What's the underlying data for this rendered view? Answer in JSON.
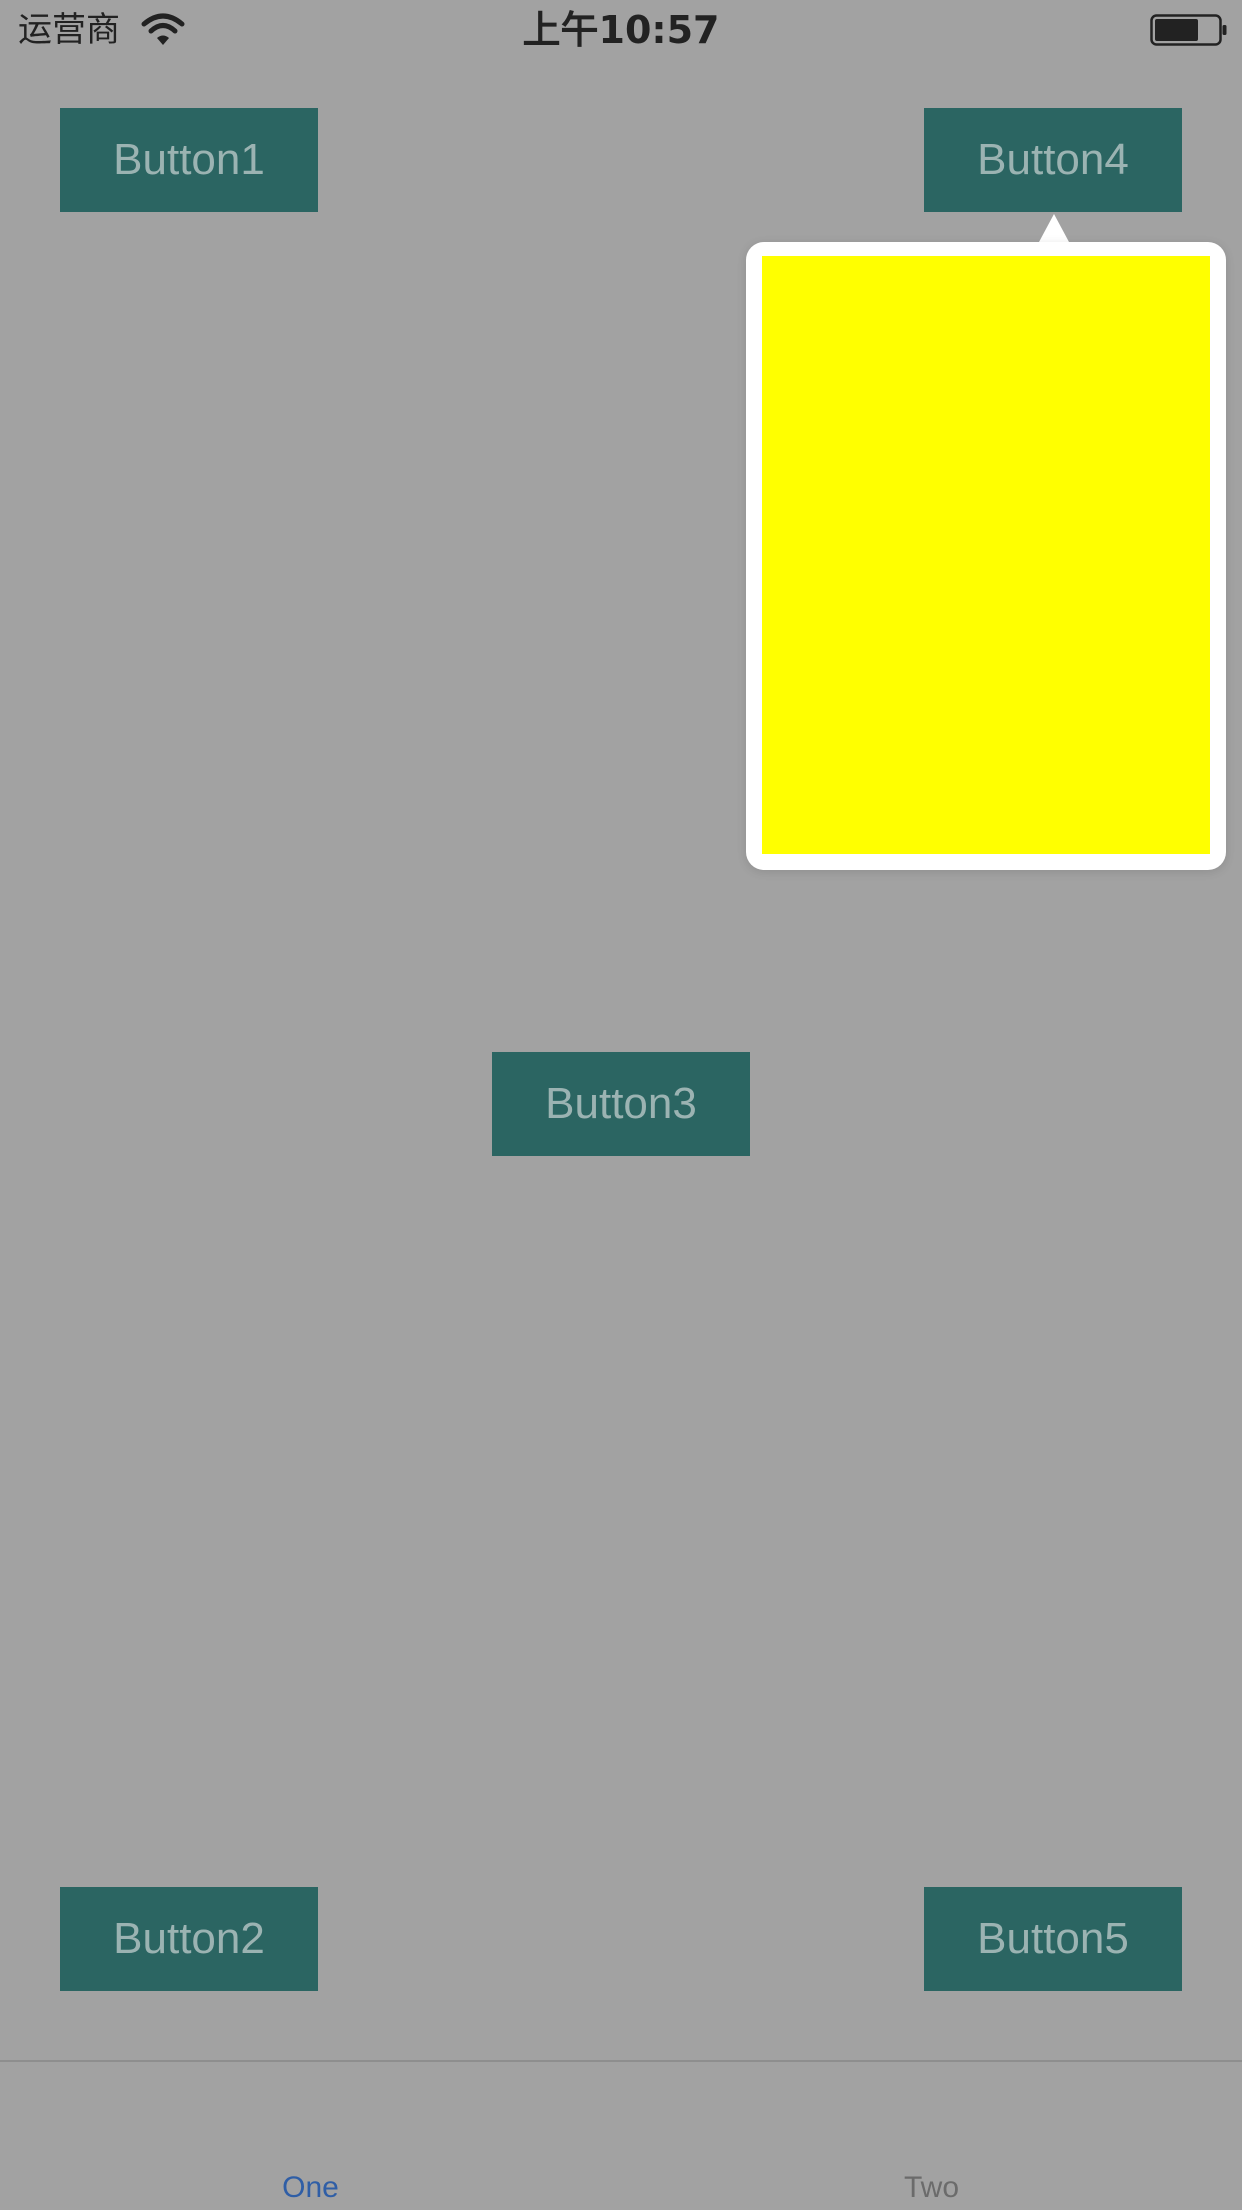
{
  "status_bar": {
    "carrier": "运营商",
    "time": "上午10:57",
    "wifi_icon": "wifi-icon",
    "battery_icon": "battery-icon"
  },
  "buttons": {
    "button1": "Button1",
    "button2": "Button2",
    "button3": "Button3",
    "button4": "Button4",
    "button5": "Button5"
  },
  "popover": {
    "content_color": "#ffff00",
    "anchored_to": "Button4"
  },
  "tab_bar": {
    "tabs": [
      {
        "label": "One",
        "selected": true
      },
      {
        "label": "Two",
        "selected": false
      }
    ]
  },
  "colors": {
    "background": "#a2a2a2",
    "button": "#2b6562",
    "button_text": "#9bb3b2",
    "tab_selected": "#2f5ea6",
    "tab_unselected": "#6b6b6b"
  }
}
